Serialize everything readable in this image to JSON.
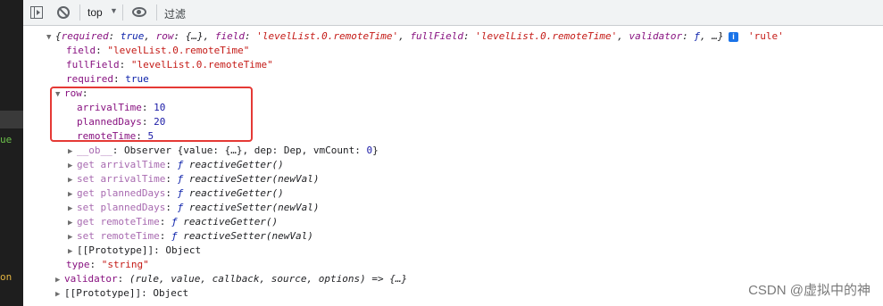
{
  "left_fragments": {
    "ue": "ue",
    "on": "on"
  },
  "toolbar": {
    "context": "top",
    "filter_placeholder": "过滤"
  },
  "console": {
    "summary": {
      "open": "{",
      "k1": "required",
      "v1": "true",
      "k2": "row",
      "v2": "{…}",
      "k3": "field",
      "v3": "'levelList.0.remoteTime'",
      "k4": "fullField",
      "v4": "'levelList.0.remoteTime'",
      "k5": "validator",
      "v5": "ƒ",
      "tail": "…}",
      "info": "i",
      "label": "'rule'"
    },
    "field": {
      "key": "field",
      "value": "\"levelList.0.remoteTime\""
    },
    "fullField": {
      "key": "fullField",
      "value": "\"levelList.0.remoteTime\""
    },
    "required": {
      "key": "required",
      "value": "true"
    },
    "row": {
      "key": "row",
      "arrivalTime": {
        "key": "arrivalTime",
        "value": "10"
      },
      "plannedDays": {
        "key": "plannedDays",
        "value": "20"
      },
      "remoteTime": {
        "key": "remoteTime",
        "value": "5"
      },
      "ob": {
        "key": "__ob__",
        "type": "Observer",
        "rest": "{value: {…}, dep: Dep, vmCount: ",
        "count": "0",
        "close": "}"
      },
      "getters": [
        {
          "label": "get arrivalTime",
          "fn": "ƒ",
          "name": "reactiveGetter()"
        },
        {
          "label": "set arrivalTime",
          "fn": "ƒ",
          "name": "reactiveSetter(newVal)"
        },
        {
          "label": "get plannedDays",
          "fn": "ƒ",
          "name": "reactiveGetter()"
        },
        {
          "label": "set plannedDays",
          "fn": "ƒ",
          "name": "reactiveSetter(newVal)"
        },
        {
          "label": "get remoteTime",
          "fn": "ƒ",
          "name": "reactiveGetter()"
        },
        {
          "label": "set remoteTime",
          "fn": "ƒ",
          "name": "reactiveSetter(newVal)"
        }
      ],
      "proto": {
        "key": "[[Prototype]]",
        "value": "Object"
      }
    },
    "type": {
      "key": "type",
      "value": "\"string\""
    },
    "validator": {
      "key": "validator",
      "value": "(rule, value, callback, source, options) => {…}"
    },
    "proto": {
      "key": "[[Prototype]]",
      "value": "Object"
    }
  },
  "watermark": "CSDN @虚拟中的神"
}
